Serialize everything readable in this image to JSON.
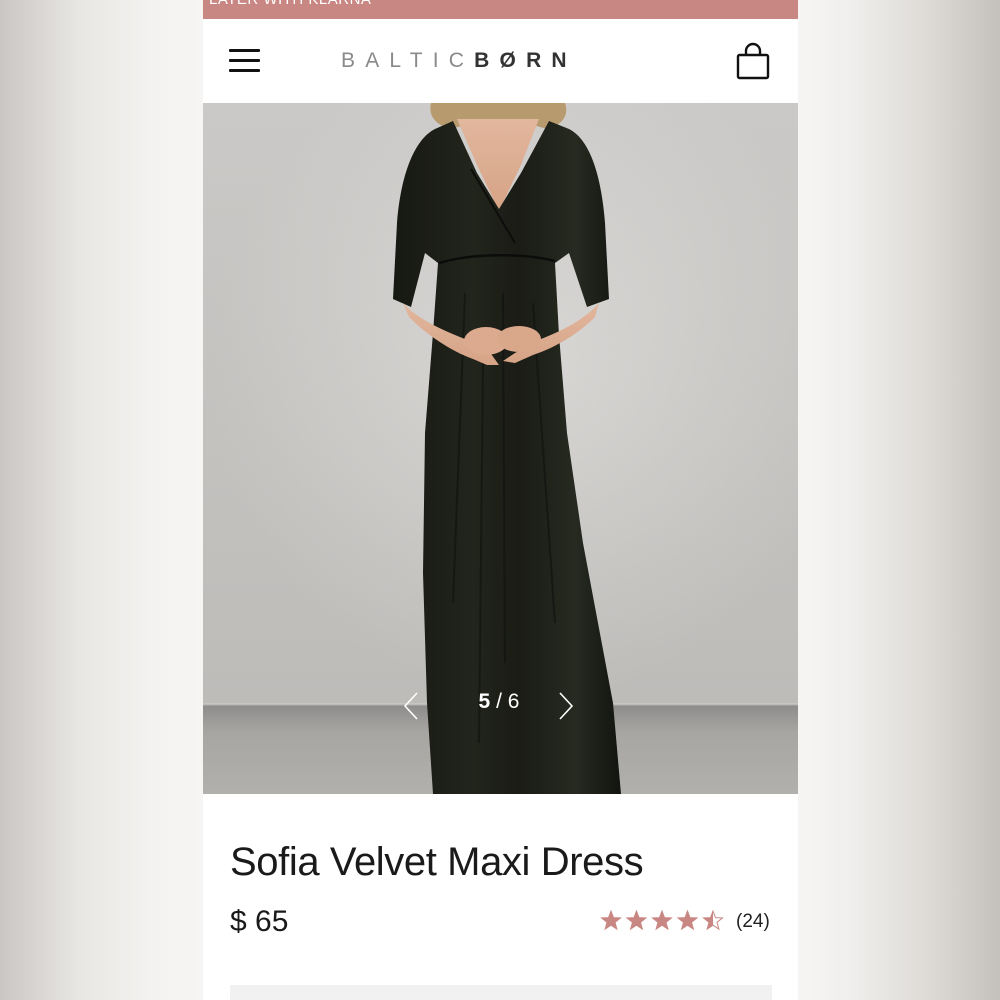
{
  "promo_banner": {
    "text": "LATER WITH KLARNA"
  },
  "header": {
    "logo_light": "BALTIC",
    "logo_dark": "BØRN",
    "menu_icon": "hamburger-menu-icon",
    "cart_icon": "shopping-bag-icon"
  },
  "gallery": {
    "current": "5",
    "separator": " / ",
    "total": "6",
    "prev_icon": "chevron-left-icon",
    "next_icon": "chevron-right-icon",
    "image_subject": "model wearing black velvet maxi dress"
  },
  "product": {
    "title": "Sofia Velvet Maxi Dress",
    "price": "$ 65",
    "rating_value": 4.5,
    "rating_max": 5,
    "review_count": "(24)"
  },
  "colors": {
    "promo_bg": "#c98784",
    "star": "#c98784",
    "text": "#1a1a1a"
  }
}
